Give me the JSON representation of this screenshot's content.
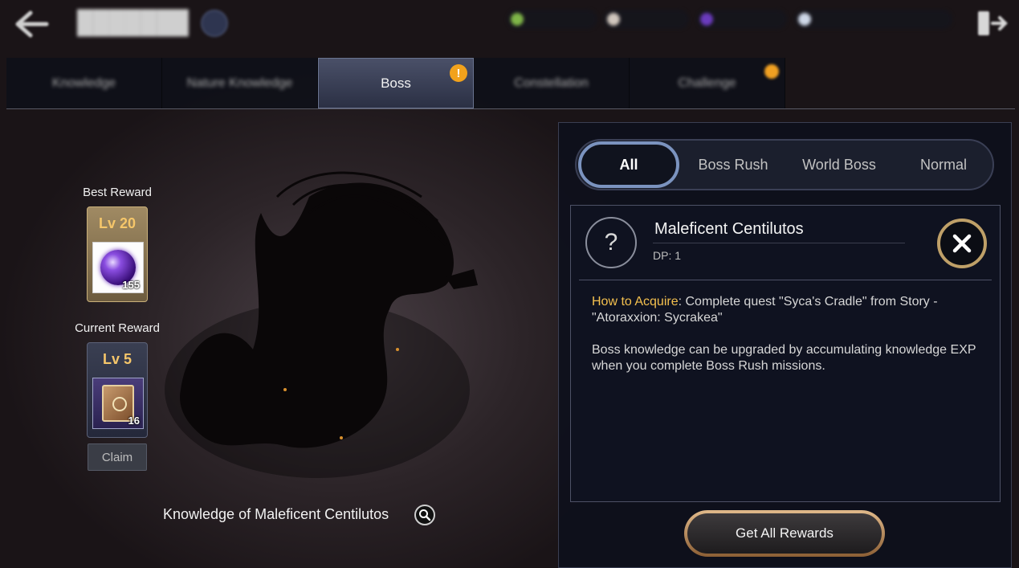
{
  "tabs": [
    {
      "label": "Knowledge",
      "active": false
    },
    {
      "label": "Nature Knowledge",
      "active": false
    },
    {
      "label": "Boss",
      "active": true,
      "alert": "!"
    },
    {
      "label": "Constellation",
      "active": false
    },
    {
      "label": "Challenge",
      "active": false
    }
  ],
  "left_column": {
    "best_reward_label": "Best Reward",
    "best_reward_level": "Lv 20",
    "best_reward_count": "155",
    "current_reward_label": "Current Reward",
    "current_reward_level": "Lv 5",
    "current_reward_count": "16",
    "claim_label": "Claim",
    "boss_knowledge_title": "Knowledge of Maleficent Centilutos"
  },
  "panel": {
    "filters": [
      "All",
      "Boss Rush",
      "World Boss",
      "Normal"
    ],
    "active_filter": "All",
    "boss": {
      "unknown_icon": "?",
      "name": "Maleficent Centilutos",
      "dp": "DP: 1"
    },
    "acquire_label": "How to Acquire",
    "acquire_text": ": Complete quest \"Syca's Cradle\" from Story - \"Atoraxxion: Sycrakea\"",
    "description": "Boss knowledge can be upgraded by accumulating knowledge EXP when you complete Boss Rush missions.",
    "get_all_label": "Get All Rewards"
  },
  "colors": {
    "accent_gold": "#f4c04e",
    "alert_orange": "#f2a21c",
    "active_filter_border": "#7b93bf"
  }
}
